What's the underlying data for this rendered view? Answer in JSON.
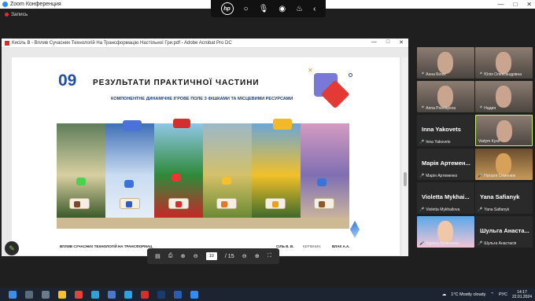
{
  "zoom": {
    "window_title": "Zoom Конференция",
    "recording_label": "Запись",
    "win_min": "—",
    "win_max": "□",
    "win_close": "✕"
  },
  "hp_toolbar": {
    "logo_text": "hp"
  },
  "acrobat": {
    "window_title": "Кисіль В - Вплив Сучасних Технологій На Трансформацію Настільної Гри.pdf - Adobe Acrobat Pro DC",
    "min": "—",
    "max": "□",
    "close": "✕",
    "toolbar": {
      "page_current": "10",
      "page_total": "/ 15"
    }
  },
  "slide": {
    "number": "09",
    "title": "РЕЗУЛЬТАТИ ПРАКТИЧНОЇ ЧАСТИНИ",
    "subtitle": "КОМПОНЕНТНЕ ДИНАМІЧНЕ ІГРОВЕ ПОЛЕ З ФІШКАМИ ТА МІСЦЕВИМИ РЕСУРСАМИ",
    "footer_left": "ВПЛИВ СУЧАСНИХ ТЕХНОЛОГІЙ НА ТРАНСФОРМАЦ",
    "footer_mid": "СІЛЬ В. В.",
    "footer_label": "КЕРІВНИК:",
    "footer_name": "ВЛАК А.А."
  },
  "participants": [
    {
      "name": "Анна Білек",
      "muted": true,
      "video": true
    },
    {
      "name": "Юлія Олександрівна",
      "muted": true,
      "video": true
    },
    {
      "name": "Anna Poletayeva",
      "muted": true,
      "video": true
    },
    {
      "name": "Надия",
      "muted": true,
      "video": true
    },
    {
      "name": "Inna Yakovets",
      "display": "Inna Yakovets",
      "muted": true,
      "video": false
    },
    {
      "name": "Vadym Kysil",
      "muted": false,
      "video": true,
      "active": true
    },
    {
      "name": "Марія Артеменко",
      "display": "Марія Артемен...",
      "muted": true,
      "video": false
    },
    {
      "name": "Наталя Семенюк",
      "muted": true,
      "video": true
    },
    {
      "name": "Violetta Mykhailova",
      "display": "Violetta Mykhai...",
      "muted": true,
      "video": false
    },
    {
      "name": "Yana Safianyk",
      "display": "Yana Safianyk",
      "muted": true,
      "video": false
    },
    {
      "name": "Карина Кравченко",
      "muted": true,
      "video": true
    },
    {
      "name": "Шульга Анастасія",
      "display": "Шульга Анаста...",
      "muted": true,
      "video": false
    }
  ],
  "taskbar": {
    "weather": "1°C Mostly cloudy",
    "lang": "РУС",
    "time": "14:17",
    "date": "22.01.2024"
  }
}
